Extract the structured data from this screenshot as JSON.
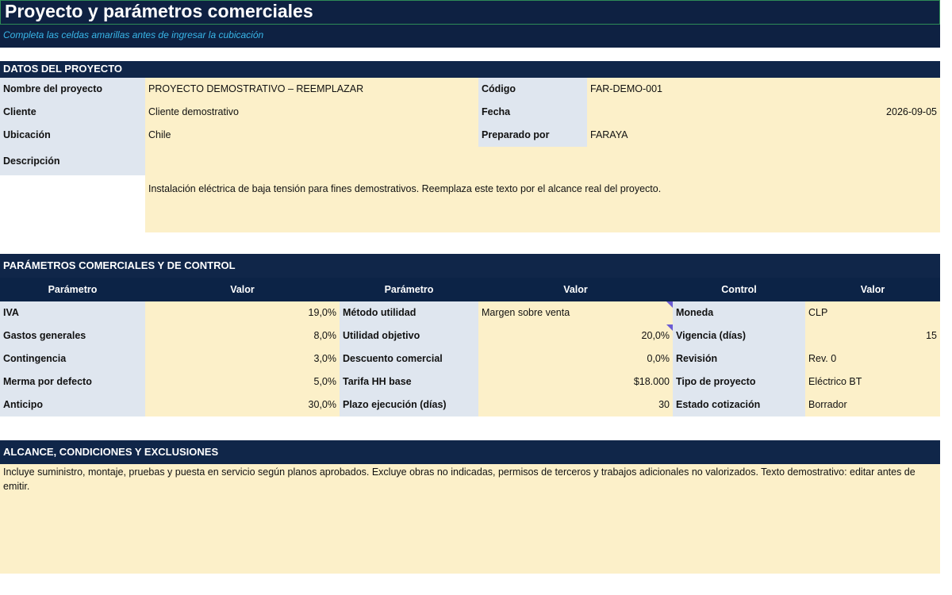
{
  "sheet": {
    "title": "Proyecto y parámetros comerciales",
    "subtitle": "Completa las celdas amarillas antes de ingresar la cubicación"
  },
  "project": {
    "header": "DATOS DEL PROYECTO",
    "name_label": "Nombre del proyecto",
    "name_value": "PROYECTO DEMOSTRATIVO – REEMPLAZAR",
    "code_label": "Código",
    "code_value": "FAR-DEMO-001",
    "client_label": "Cliente",
    "client_value": "Cliente demostrativo",
    "date_label": "Fecha",
    "date_value": "2026-09-05",
    "location_label": "Ubicación",
    "location_value": "Chile",
    "prepared_label": "Preparado por",
    "prepared_value": "FARAYA",
    "description_label": "Descripción",
    "description_value": "Instalación eléctrica de baja tensión para fines demostrativos. Reemplaza este texto por el alcance real del proyecto."
  },
  "commercial": {
    "header": "PARÁMETROS COMERCIALES Y DE CONTROL",
    "columns": [
      "Parámetro",
      "Valor",
      "Parámetro",
      "Valor",
      "Control",
      "Valor"
    ],
    "rows": [
      {
        "p1": "IVA",
        "v1": "19,0%",
        "p2": "Método utilidad",
        "v2": "Margen sobre venta",
        "c": "Moneda",
        "cv": "CLP"
      },
      {
        "p1": "Gastos generales",
        "v1": "8,0%",
        "p2": "Utilidad objetivo",
        "v2": "20,0%",
        "c": "Vigencia (días)",
        "cv": "15"
      },
      {
        "p1": "Contingencia",
        "v1": "3,0%",
        "p2": "Descuento comercial",
        "v2": "0,0%",
        "c": "Revisión",
        "cv": "Rev. 0"
      },
      {
        "p1": "Merma por defecto",
        "v1": "5,0%",
        "p2": "Tarifa HH base",
        "v2": "$18.000",
        "c": "Tipo de proyecto",
        "cv": "Eléctrico BT"
      },
      {
        "p1": "Anticipo",
        "v1": "30,0%",
        "p2": "Plazo ejecución (días)",
        "v2": "30",
        "c": "Estado cotización",
        "cv": "Borrador"
      }
    ]
  },
  "scope": {
    "header": "ALCANCE, CONDICIONES Y EXCLUSIONES",
    "text": "Incluye suministro, montaje, pruebas y puesta en servicio según planos aprobados. Excluye obras no indicadas, permisos de terceros y trabajos adicionales no valorizados. Texto demostrativo: editar antes de emitir."
  },
  "colors": {
    "header_navy": "#102649",
    "label_fill": "#dfe6ef",
    "input_fill": "#fcf0c9",
    "subtitle_text": "#39b6e8",
    "comment_marker": "#6a5bd3"
  }
}
